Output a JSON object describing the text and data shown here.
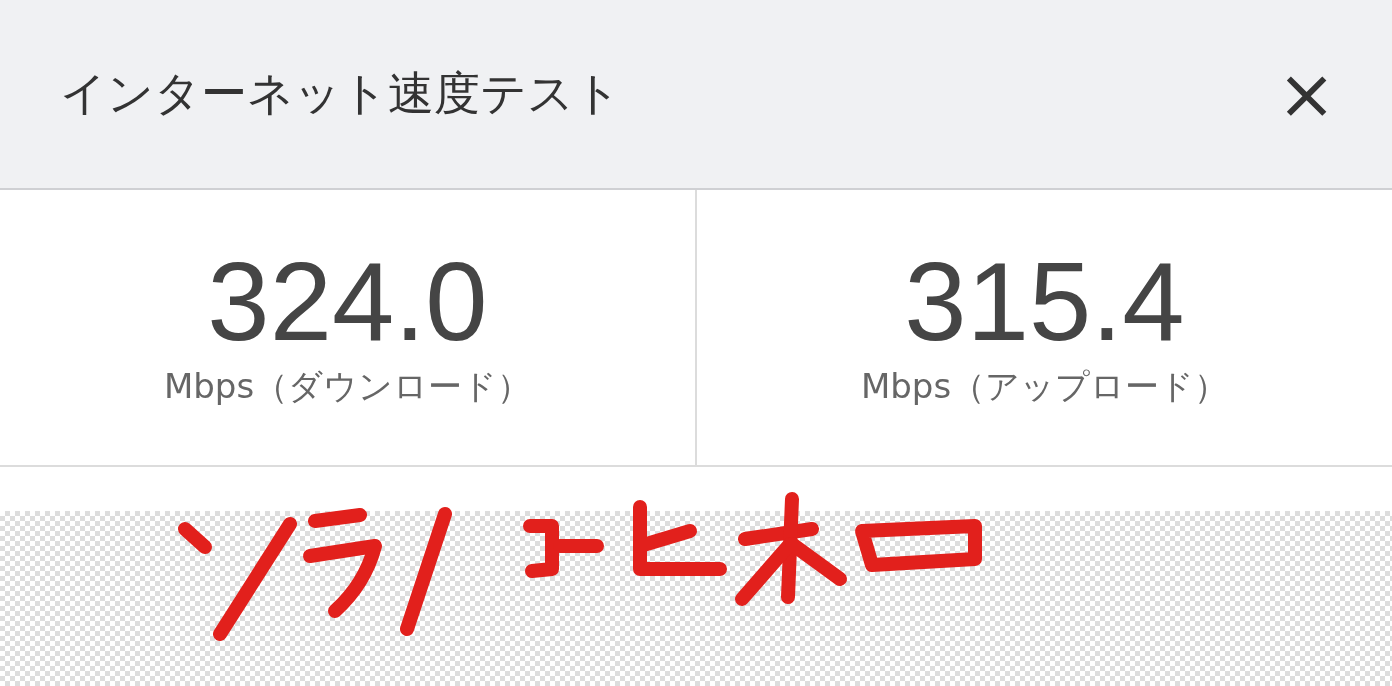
{
  "dialog": {
    "title": "インターネット速度テスト",
    "close": "×"
  },
  "results": [
    {
      "value": "324.0",
      "unit": "Mbps（ダウンロード）"
    },
    {
      "value": "315.4",
      "unit": "Mbps（アップロード）"
    }
  ]
}
